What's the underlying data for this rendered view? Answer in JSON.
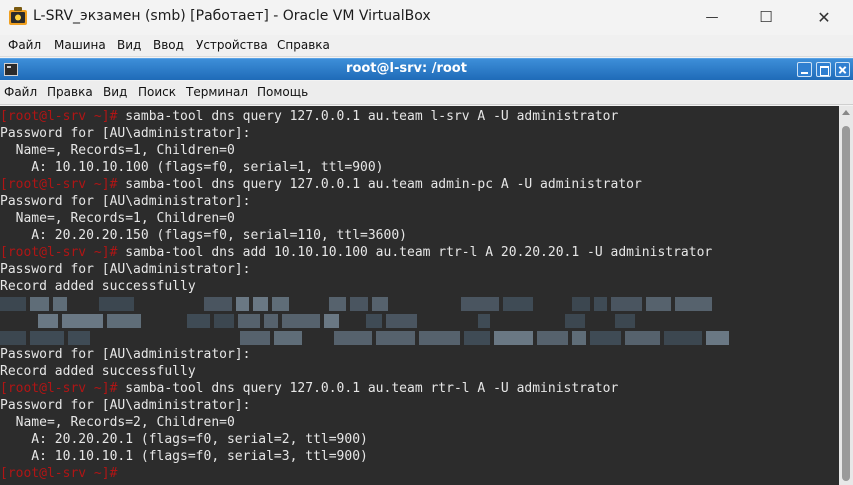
{
  "window": {
    "title": "L-SRV_экзамен (smb) [Работает] - Oracle VM VirtualBox",
    "controls": {
      "minimize": "—",
      "maximize": "☐",
      "close": "✕"
    }
  },
  "vbox_menu": [
    "Файл",
    "Машина",
    "Вид",
    "Ввод",
    "Устройства",
    "Справка"
  ],
  "terminal": {
    "title": "root@l-srv: /root",
    "menu": [
      "Файл",
      "Правка",
      "Вид",
      "Поиск",
      "Терминал",
      "Помощь"
    ],
    "prompt": "[root@l-srv ~]#",
    "lines": [
      {
        "prompt": true,
        "text": " samba-tool dns query 127.0.0.1 au.team l-srv A -U administrator"
      },
      {
        "prompt": false,
        "text": "Password for [AU\\administrator]:"
      },
      {
        "prompt": false,
        "text": "  Name=, Records=1, Children=0"
      },
      {
        "prompt": false,
        "text": "    A: 10.10.10.100 (flags=f0, serial=1, ttl=900)"
      },
      {
        "prompt": true,
        "text": " samba-tool dns query 127.0.0.1 au.team admin-pc A -U administrator"
      },
      {
        "prompt": false,
        "text": "Password for [AU\\administrator]:"
      },
      {
        "prompt": false,
        "text": "  Name=, Records=1, Children=0"
      },
      {
        "prompt": false,
        "text": "    A: 20.20.20.150 (flags=f0, serial=110, ttl=3600)"
      },
      {
        "prompt": true,
        "text": " samba-tool dns add 10.10.10.100 au.team rtr-l A 20.20.20.1 -U administrator"
      },
      {
        "prompt": false,
        "text": "Password for [AU\\administrator]:"
      },
      {
        "prompt": false,
        "text": "Record added successfully"
      },
      {
        "blurred": true,
        "text": ""
      },
      {
        "blurred": true,
        "text": ""
      },
      {
        "blurred": true,
        "text": ""
      },
      {
        "prompt": false,
        "text": "Password for [AU\\administrator]:"
      },
      {
        "prompt": false,
        "text": "Record added successfully"
      },
      {
        "prompt": true,
        "text": " samba-tool dns query 127.0.0.1 au.team rtr-l A -U administrator"
      },
      {
        "prompt": false,
        "text": "Password for [AU\\administrator]:"
      },
      {
        "prompt": false,
        "text": "  Name=, Records=2, Children=0"
      },
      {
        "prompt": false,
        "text": "    A: 20.20.20.1 (flags=f0, serial=2, ttl=900)"
      },
      {
        "prompt": false,
        "text": "    A: 10.10.10.1 (flags=f0, serial=3, ttl=900)"
      },
      {
        "prompt": true,
        "text": ""
      }
    ]
  },
  "colors": {
    "terminal_bg": "#2c2c2c",
    "terminal_fg": "#e6e6e6",
    "prompt": "#b01515",
    "title_bar": "#1f6bb8"
  }
}
